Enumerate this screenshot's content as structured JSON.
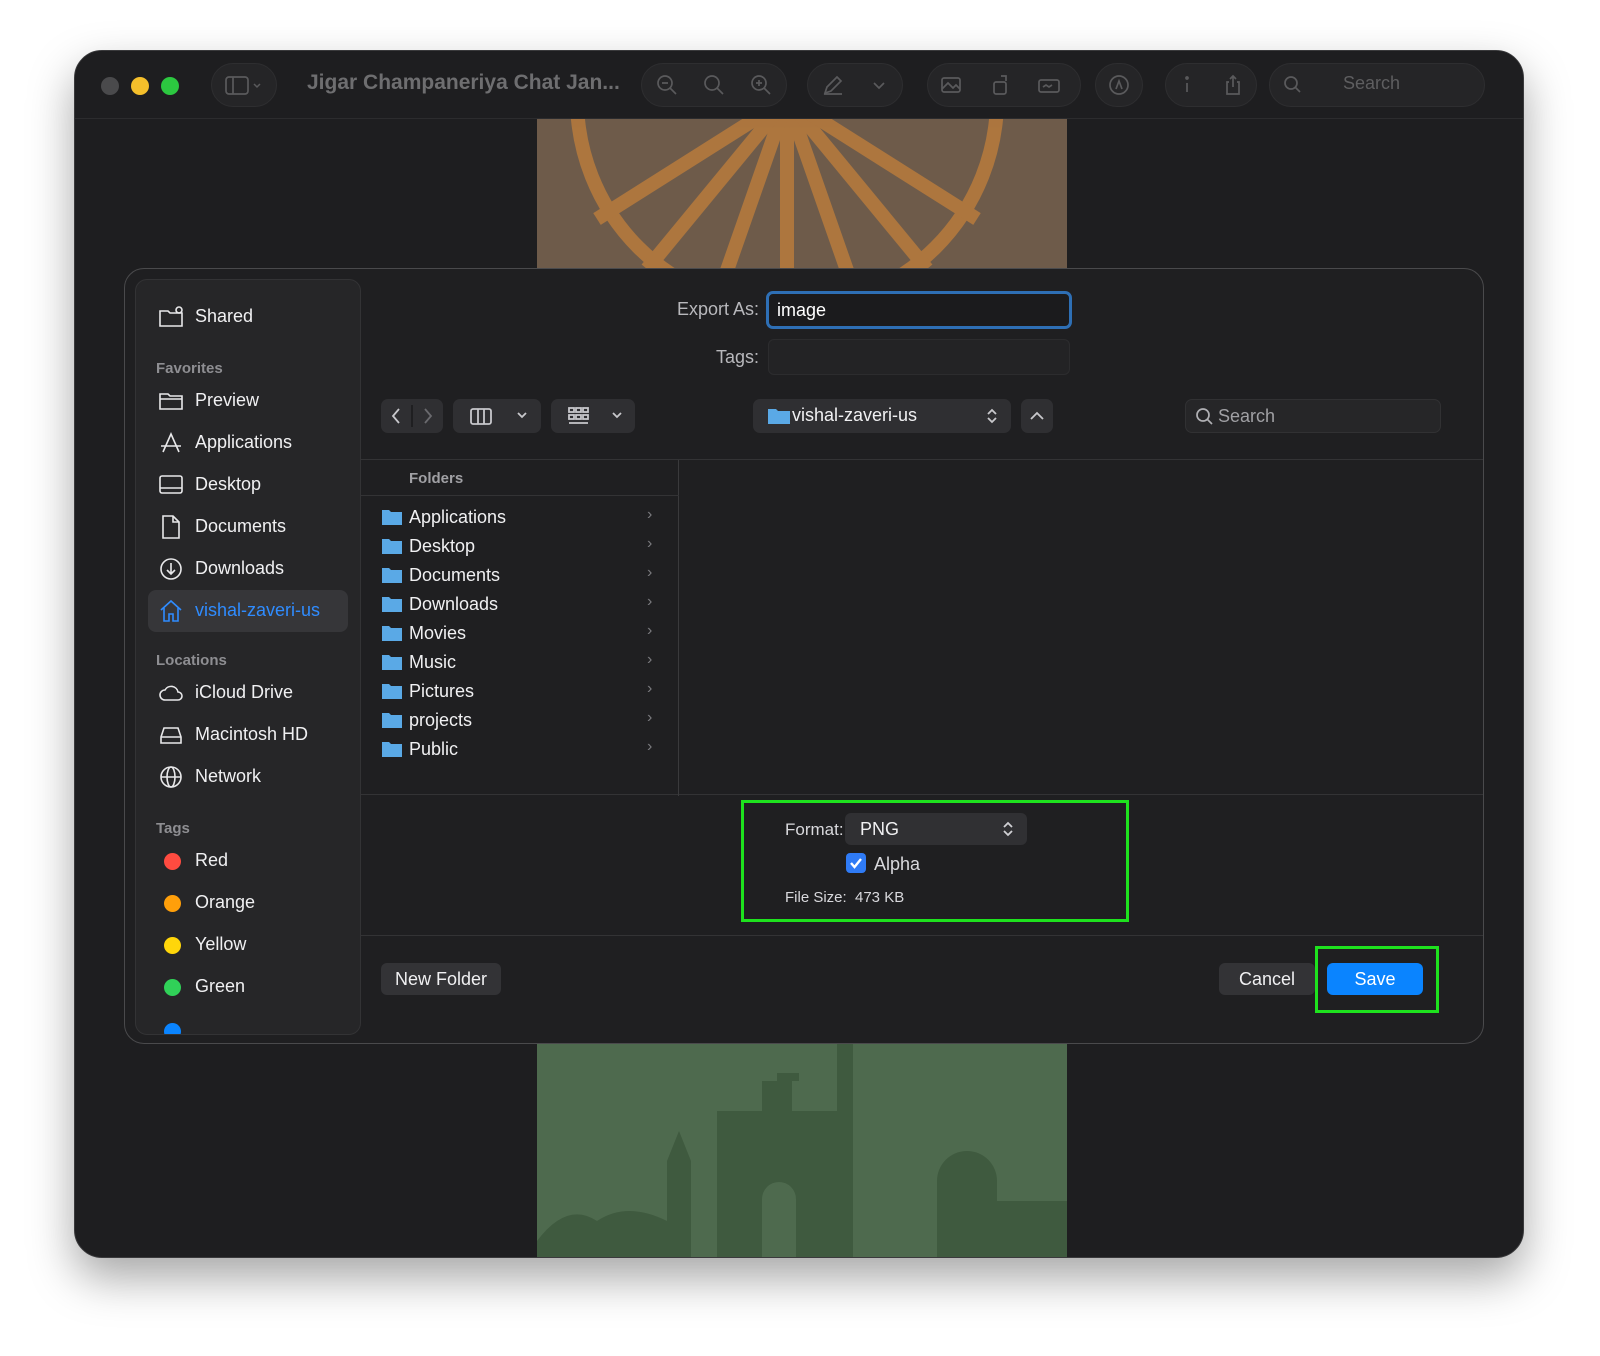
{
  "window": {
    "title": "Jigar Champaneriya Chat Jan...",
    "toolbar_search_placeholder": "Search"
  },
  "sidebar": {
    "shared_label": "Shared",
    "favorites_header": "Favorites",
    "favorites": [
      {
        "label": "Preview",
        "icon": "folder-icon"
      },
      {
        "label": "Applications",
        "icon": "applications-icon"
      },
      {
        "label": "Desktop",
        "icon": "desktop-icon"
      },
      {
        "label": "Documents",
        "icon": "document-icon"
      },
      {
        "label": "Downloads",
        "icon": "download-icon"
      },
      {
        "label": "vishal-zaveri-us",
        "icon": "home-icon",
        "selected": true
      }
    ],
    "locations_header": "Locations",
    "locations": [
      {
        "label": "iCloud Drive",
        "icon": "cloud-icon"
      },
      {
        "label": "Macintosh HD",
        "icon": "disk-icon"
      },
      {
        "label": "Network",
        "icon": "globe-icon"
      }
    ],
    "tags_header": "Tags",
    "tags": [
      {
        "label": "Red",
        "color": "#ff4b40"
      },
      {
        "label": "Orange",
        "color": "#ff9f0a"
      },
      {
        "label": "Yellow",
        "color": "#ffd60a"
      },
      {
        "label": "Green",
        "color": "#30d158"
      }
    ]
  },
  "form": {
    "export_as_label": "Export As:",
    "export_as_value": "image",
    "tags_label": "Tags:"
  },
  "toolbar": {
    "location": "vishal-zaveri-us",
    "search_placeholder": "Search"
  },
  "browser": {
    "column_header": "Folders",
    "folders": [
      "Applications",
      "Desktop",
      "Documents",
      "Downloads",
      "Movies",
      "Music",
      "Pictures",
      "projects",
      "Public"
    ]
  },
  "options": {
    "format_label": "Format:",
    "format_value": "PNG",
    "alpha_label": "Alpha",
    "alpha_checked": true,
    "file_size_label": "File Size:",
    "file_size_value": "473 KB"
  },
  "buttons": {
    "new_folder": "New Folder",
    "cancel": "Cancel",
    "save": "Save"
  },
  "colors": {
    "accent": "#0a84ff",
    "highlight": "#1ee21e",
    "folder": "#5aa9e6"
  }
}
